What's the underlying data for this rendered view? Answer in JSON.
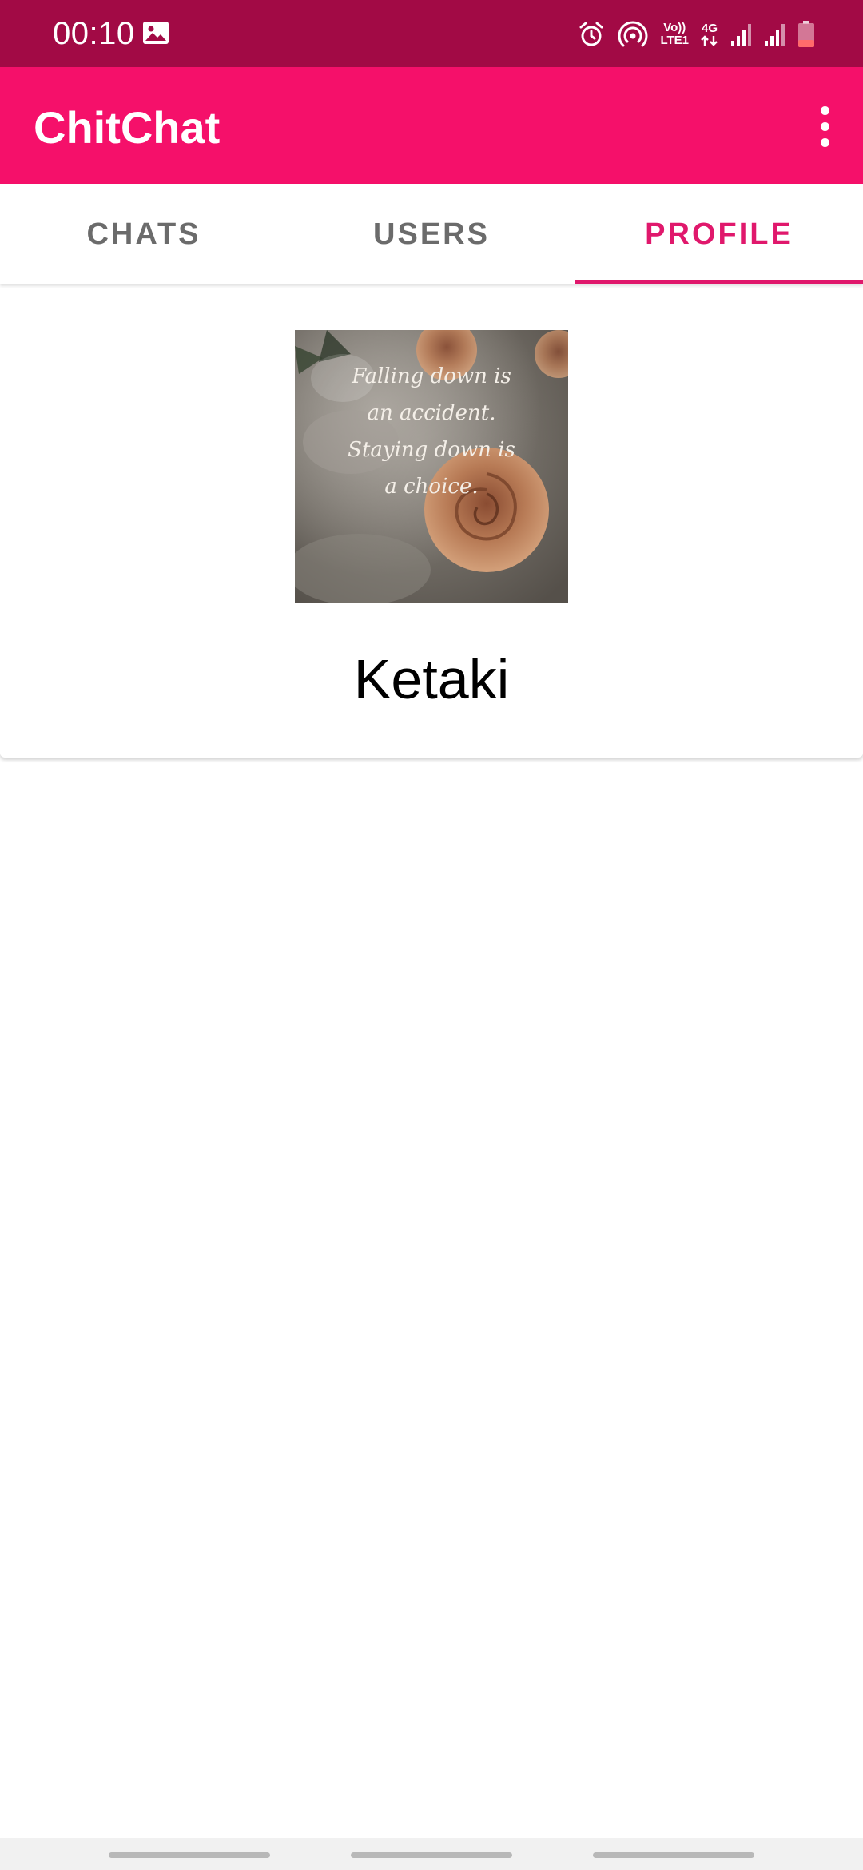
{
  "status_bar": {
    "time": "00:10",
    "volte_label_top": "Vo))",
    "volte_label_bottom": "LTE1",
    "network_label": "4G",
    "icons": [
      "gallery-icon",
      "alarm-icon",
      "hotspot-icon",
      "signal-icon",
      "signal-icon",
      "battery-icon"
    ],
    "battery_color": "#ff6b6b"
  },
  "app_bar": {
    "title": "ChitChat",
    "menu_icon": "more-vert-icon",
    "background": "#f5106a"
  },
  "tabs": [
    {
      "label": "CHATS",
      "active": false
    },
    {
      "label": "USERS",
      "active": false
    },
    {
      "label": "PROFILE",
      "active": true
    }
  ],
  "profile": {
    "name": "Ketaki",
    "image_quote_lines": [
      "Falling down is",
      "an accident.",
      "Staying down is",
      "a choice."
    ]
  },
  "colors": {
    "status_bar": "#a20a45",
    "accent": "#e0186c",
    "tab_inactive": "#6b6b6b"
  }
}
